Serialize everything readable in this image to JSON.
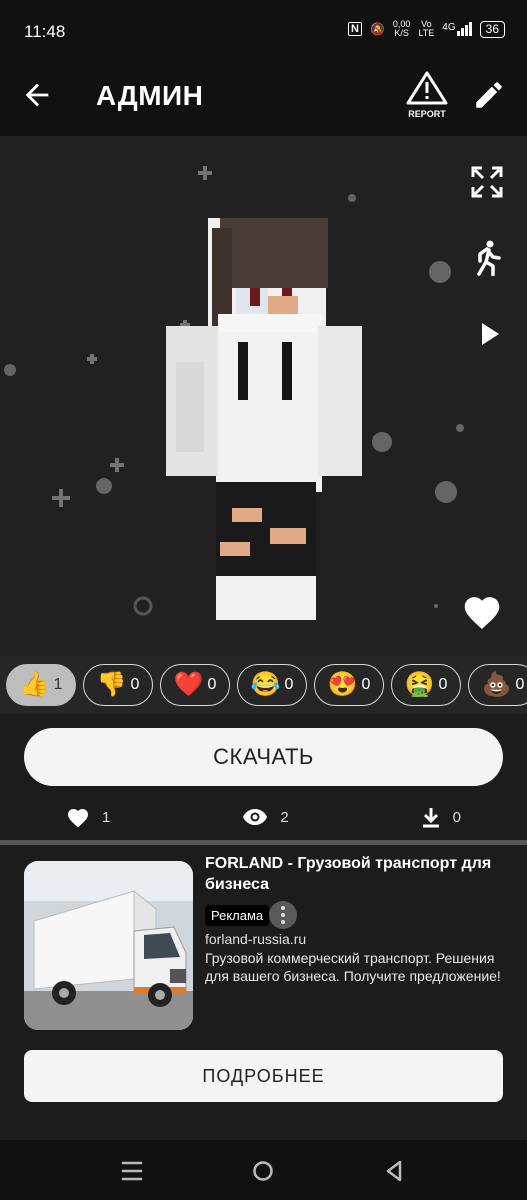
{
  "status_bar": {
    "time": "11:48",
    "nfc": "N",
    "speed_value": "0,00",
    "speed_unit": "K/S",
    "volte_top": "Vo",
    "volte_bottom": "LTE",
    "network": "4G",
    "battery": "36"
  },
  "app_bar": {
    "title": "АДМИН",
    "report_label": "REPORT",
    "back_icon": "arrow-left-icon",
    "edit_icon": "pencil-icon"
  },
  "viewer": {
    "controls": [
      "fullscreen-icon",
      "walk-icon",
      "play-icon"
    ],
    "favorite_icon": "heart-icon"
  },
  "reactions": [
    {
      "emoji": "👍",
      "count": "1",
      "active": true
    },
    {
      "emoji": "👎",
      "count": "0"
    },
    {
      "emoji": "❤️",
      "count": "0"
    },
    {
      "emoji": "😂",
      "count": "0"
    },
    {
      "emoji": "😍",
      "count": "0"
    },
    {
      "emoji": "🤮",
      "count": "0"
    },
    {
      "emoji": "💩",
      "count": "0"
    }
  ],
  "download_button": "СКАЧАТЬ",
  "stats": {
    "likes": "1",
    "views": "2",
    "downloads": "0"
  },
  "ad": {
    "title": "FORLAND - Грузовой транспорт для бизнеса",
    "badge": "Реклама",
    "domain": "forland-russia.ru",
    "description": "Грузовой коммерческий транспорт. Решения для вашего бизнеса. Получите предложение!",
    "cta": "ПОДРОБНЕЕ"
  },
  "colors": {
    "background": "#1c1c1c",
    "viewer": "#212121",
    "button": "#f4f4f4",
    "active_chip": "#bdbdbd"
  }
}
